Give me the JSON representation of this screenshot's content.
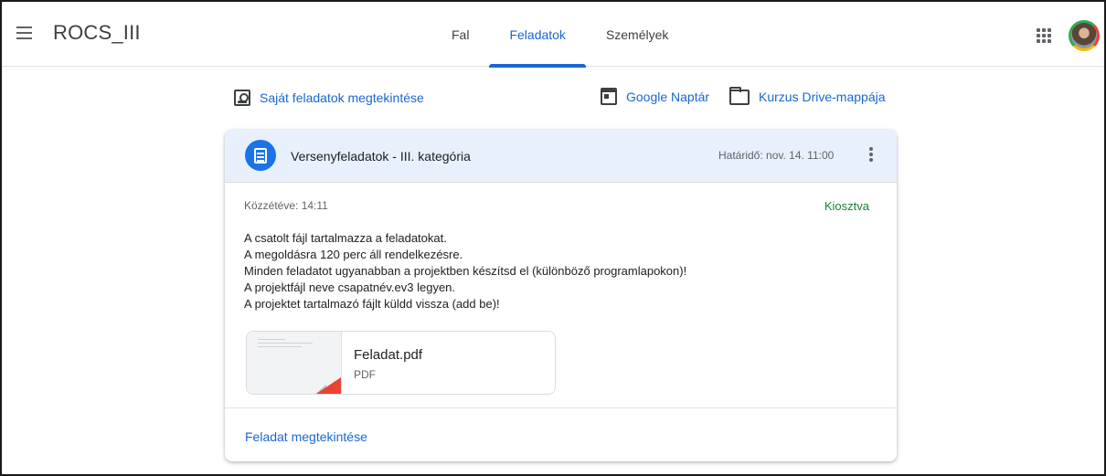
{
  "header": {
    "app_title": "ROCS_III",
    "tabs": [
      {
        "label": "Fal",
        "active": false
      },
      {
        "label": "Feladatok",
        "active": true
      },
      {
        "label": "Személyek",
        "active": false
      }
    ],
    "menu_icon": "hamburger-menu-icon",
    "apps_icon": "apps-grid-icon",
    "avatar_icon": "user-avatar"
  },
  "actions": {
    "own_tasks": "Saját feladatok megtekintése",
    "google_calendar": "Google Naptár",
    "drive_folder": "Kurzus Drive-mappája"
  },
  "assignment": {
    "title": "Versenyfeladatok - III. kategória",
    "due": "Határidő: nov. 14. 11:00",
    "posted": "Közzétéve: 14:11",
    "status": "Kiosztva",
    "description": [
      "A csatolt fájl tartalmazza a feladatokat.",
      "A megoldásra 120 perc áll rendelkezésre.",
      "Minden feladatot ugyanabban a projektben készítsd el (különböző programlapokon)!",
      "A projektfájl neve csapatnév.ev3 legyen.",
      "A projektet tartalmazó fájlt küldd vissza (add be)!"
    ],
    "attachment": {
      "name": "Feladat.pdf",
      "type": "PDF"
    },
    "view_link": "Feladat megtekintése"
  },
  "colors": {
    "accent": "#1967d2",
    "header_bg": "#e8f0fe",
    "status_green": "#188038",
    "pdf_red": "#ea4335"
  }
}
